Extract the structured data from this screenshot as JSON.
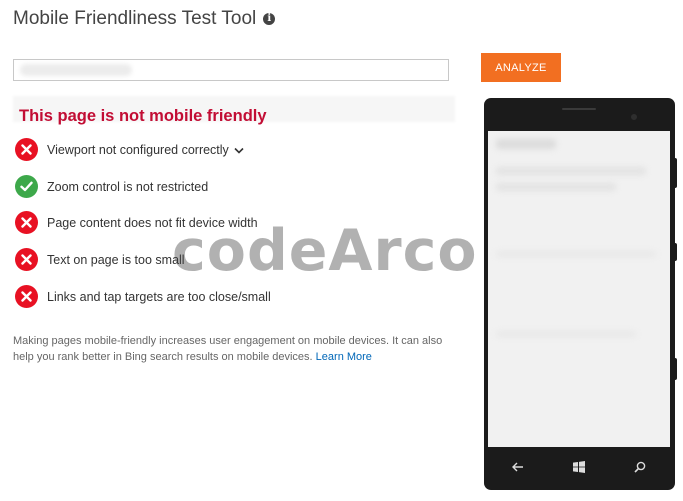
{
  "header": {
    "title": "Mobile Friendliness Test Tool",
    "info_glyph": "i"
  },
  "search": {
    "url_value": "",
    "analyze_label": "ANALYZE"
  },
  "result": {
    "heading": "This page is not mobile friendly",
    "checks": [
      {
        "label": "Viewport not configured correctly",
        "status": "fail",
        "expandable": true
      },
      {
        "label": "Zoom control is not restricted",
        "status": "pass"
      },
      {
        "label": "Page content does not fit device width",
        "status": "fail"
      },
      {
        "label": "Text on page is too small",
        "status": "fail"
      },
      {
        "label": "Links and tap targets are too close/small",
        "status": "fail"
      }
    ]
  },
  "note": {
    "text": "Making pages mobile-friendly increases user engagement on mobile devices. It can also help you rank better in Bing search results on mobile devices.",
    "link_label": "Learn More"
  },
  "watermark": "codeArco",
  "colors": {
    "accent": "#f26f21",
    "heading_red": "#c20d34",
    "fail_red": "#e81123",
    "pass_green": "#3da84a",
    "link_blue": "#0067b8"
  },
  "phone": {
    "nav_icons": [
      "back-arrow-icon",
      "windows-logo-icon",
      "search-icon"
    ]
  }
}
